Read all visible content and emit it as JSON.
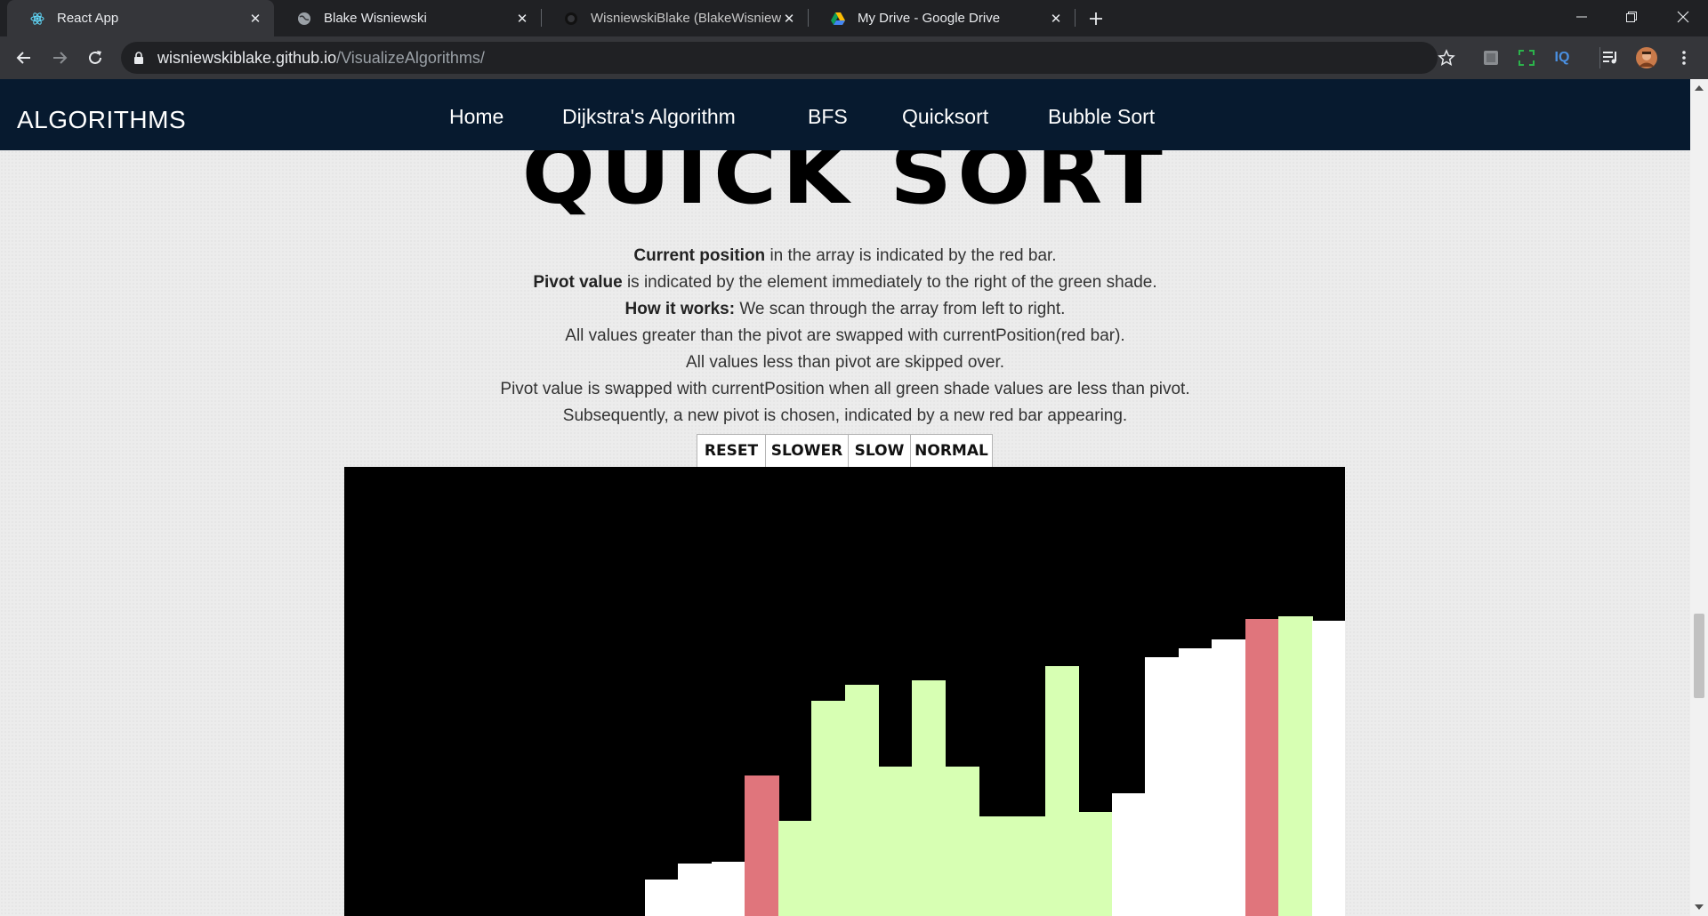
{
  "browser": {
    "tabs": [
      {
        "title": "React App",
        "favicon": "react-icon",
        "active": true
      },
      {
        "title": "Blake Wisniewski",
        "favicon": "globe-icon",
        "active": false
      },
      {
        "title": "WisniewskiBlake (BlakeWisniewski)",
        "favicon": "github-icon",
        "active": false
      },
      {
        "title": "My Drive - Google Drive",
        "favicon": "google-drive-icon",
        "active": false
      }
    ],
    "url_host": "wisniewskiblake.github.io",
    "url_path": "/VisualizeAlgorithms/",
    "extension_iq_label": "IQ"
  },
  "site": {
    "brand": "ALGORITHMS",
    "nav": [
      "Home",
      "Dijkstra's Algorithm",
      "BFS",
      "Quicksort",
      "Bubble Sort"
    ],
    "heading": "QUICK SORT",
    "description": [
      {
        "bold": "Current position",
        "text": " in the array is indicated by the red bar."
      },
      {
        "bold": "Pivot value",
        "text": " is indicated by the element immediately to the right of the green shade."
      },
      {
        "bold": "How it works:",
        "text": " We scan through the array from left to right."
      },
      {
        "bold": "",
        "text": "All values greater than the pivot are swapped with currentPosition(red bar)."
      },
      {
        "bold": "",
        "text": "All values less than pivot are skipped over."
      },
      {
        "bold": "",
        "text": "Pivot value is swapped with currentPosition when all green shade values are less than pivot."
      },
      {
        "bold": "",
        "text": "Subsequently, a new pivot is chosen, indicated by a new red bar appearing."
      }
    ],
    "controls": [
      "RESET",
      "SLOWER",
      "SLOW",
      "NORMAL"
    ]
  },
  "colors": {
    "navbar": "#071a2f",
    "canvas": "#000000",
    "bar_default": "#ffffff",
    "bar_current": "#e0757c",
    "bar_range": "#d7ffb3"
  },
  "visualizer": {
    "max_value": 100,
    "bars": [
      {
        "value": 0,
        "state": "default"
      },
      {
        "value": 0,
        "state": "default"
      },
      {
        "value": 0,
        "state": "default"
      },
      {
        "value": 0,
        "state": "default"
      },
      {
        "value": 0,
        "state": "default"
      },
      {
        "value": 0,
        "state": "default"
      },
      {
        "value": 0,
        "state": "default"
      },
      {
        "value": 0,
        "state": "default"
      },
      {
        "value": 0,
        "state": "default"
      },
      {
        "value": 9,
        "state": "default"
      },
      {
        "value": 12.5,
        "state": "default"
      },
      {
        "value": 13,
        "state": "default"
      },
      {
        "value": 32,
        "state": "current"
      },
      {
        "value": 22,
        "state": "range"
      },
      {
        "value": 48.5,
        "state": "range"
      },
      {
        "value": 52,
        "state": "range"
      },
      {
        "value": 34,
        "state": "range"
      },
      {
        "value": 53,
        "state": "range"
      },
      {
        "value": 34,
        "state": "range"
      },
      {
        "value": 23,
        "state": "range"
      },
      {
        "value": 23,
        "state": "range"
      },
      {
        "value": 56,
        "state": "range"
      },
      {
        "value": 24,
        "state": "range"
      },
      {
        "value": 28,
        "state": "default"
      },
      {
        "value": 58,
        "state": "default"
      },
      {
        "value": 60,
        "state": "default"
      },
      {
        "value": 62,
        "state": "default"
      },
      {
        "value": 66.5,
        "state": "current"
      },
      {
        "value": 67,
        "state": "range"
      },
      {
        "value": 66,
        "state": "default"
      }
    ]
  }
}
